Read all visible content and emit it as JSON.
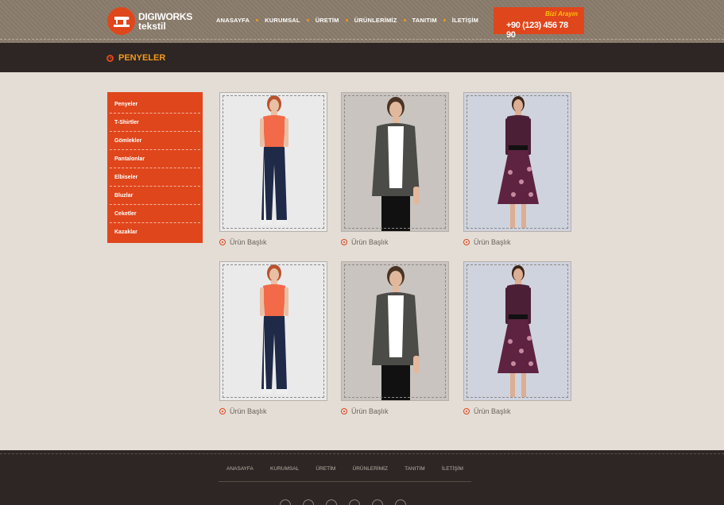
{
  "header": {
    "logo_top": "DIGIWORKS",
    "logo_bottom": "tekstil",
    "nav": [
      "ANASAYFA",
      "KURUMSAL",
      "ÜRETİM",
      "ÜRÜNLERİMİZ",
      "TANITIM",
      "İLETİŞİM"
    ],
    "call_label": "Bizi Arayın",
    "phone": "+90 (123) 456 78 90"
  },
  "page": {
    "title": "PENYELER"
  },
  "sidebar": {
    "items": [
      "Penyeler",
      "T-Shirtler",
      "Gömlekler",
      "Pantalonlar",
      "Elbiseler",
      "Bluzlar",
      "Ceketler",
      "Kazaklar"
    ]
  },
  "products": [
    {
      "title": "Ürün Başlık"
    },
    {
      "title": "Ürün Başlık"
    },
    {
      "title": "Ürün Başlık"
    },
    {
      "title": "Ürün Başlık"
    },
    {
      "title": "Ürün Başlık"
    },
    {
      "title": "Ürün Başlık"
    }
  ],
  "footer": {
    "nav": [
      "ANASAYFA",
      "KURUMSAL",
      "ÜRETİM",
      "ÜRÜNLERİMİZ",
      "TANITIM",
      "İLETİŞİM"
    ]
  },
  "colors": {
    "accent": "#e0461b",
    "title": "#f39a1e",
    "dark": "#2e2624",
    "header": "#8a7c6b"
  }
}
